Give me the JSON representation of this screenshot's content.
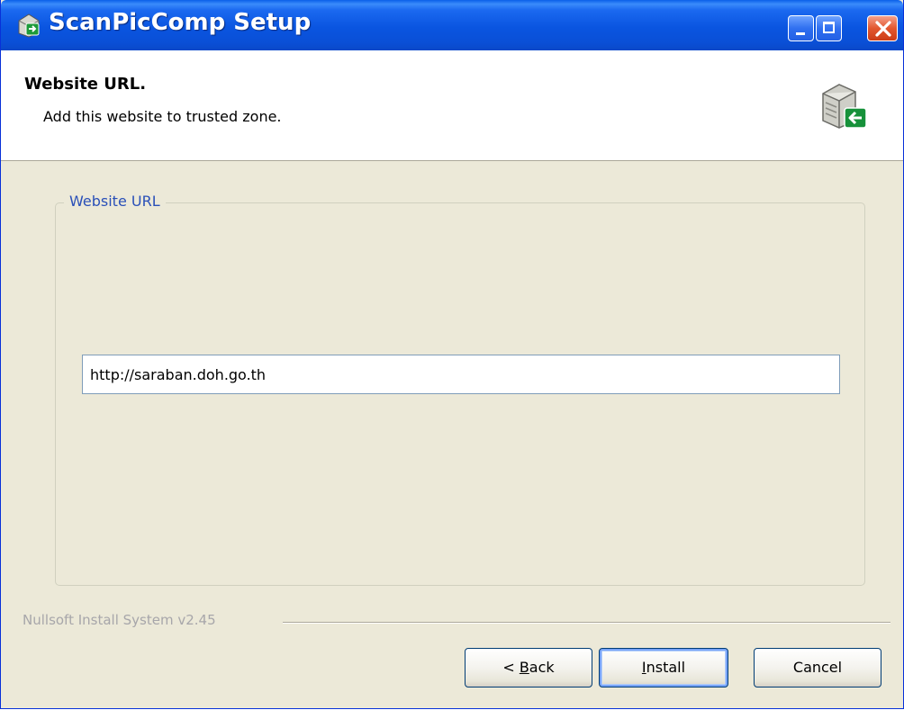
{
  "window": {
    "title": "ScanPicComp Setup"
  },
  "header": {
    "title": "Website URL.",
    "subtitle": "Add this website to trusted zone."
  },
  "group": {
    "label": "Website URL",
    "url_value": "http://saraban.doh.go.th"
  },
  "footer": {
    "branding": "Nullsoft Install System v2.45"
  },
  "buttons": {
    "back_prefix": "< ",
    "back_accel": "B",
    "back_rest": "ack",
    "install_accel": "I",
    "install_rest": "nstall",
    "cancel": "Cancel"
  },
  "icons": {
    "title_icon": "installer-icon",
    "header_icon": "server-install-icon",
    "minimize": "minimize-icon",
    "maximize": "maximize-icon",
    "close": "close-icon"
  },
  "colors": {
    "titlebar": "#0a55e0",
    "dialog_bg": "#ece9d8",
    "group_label": "#2a50b8",
    "close_button": "#e2572f"
  }
}
